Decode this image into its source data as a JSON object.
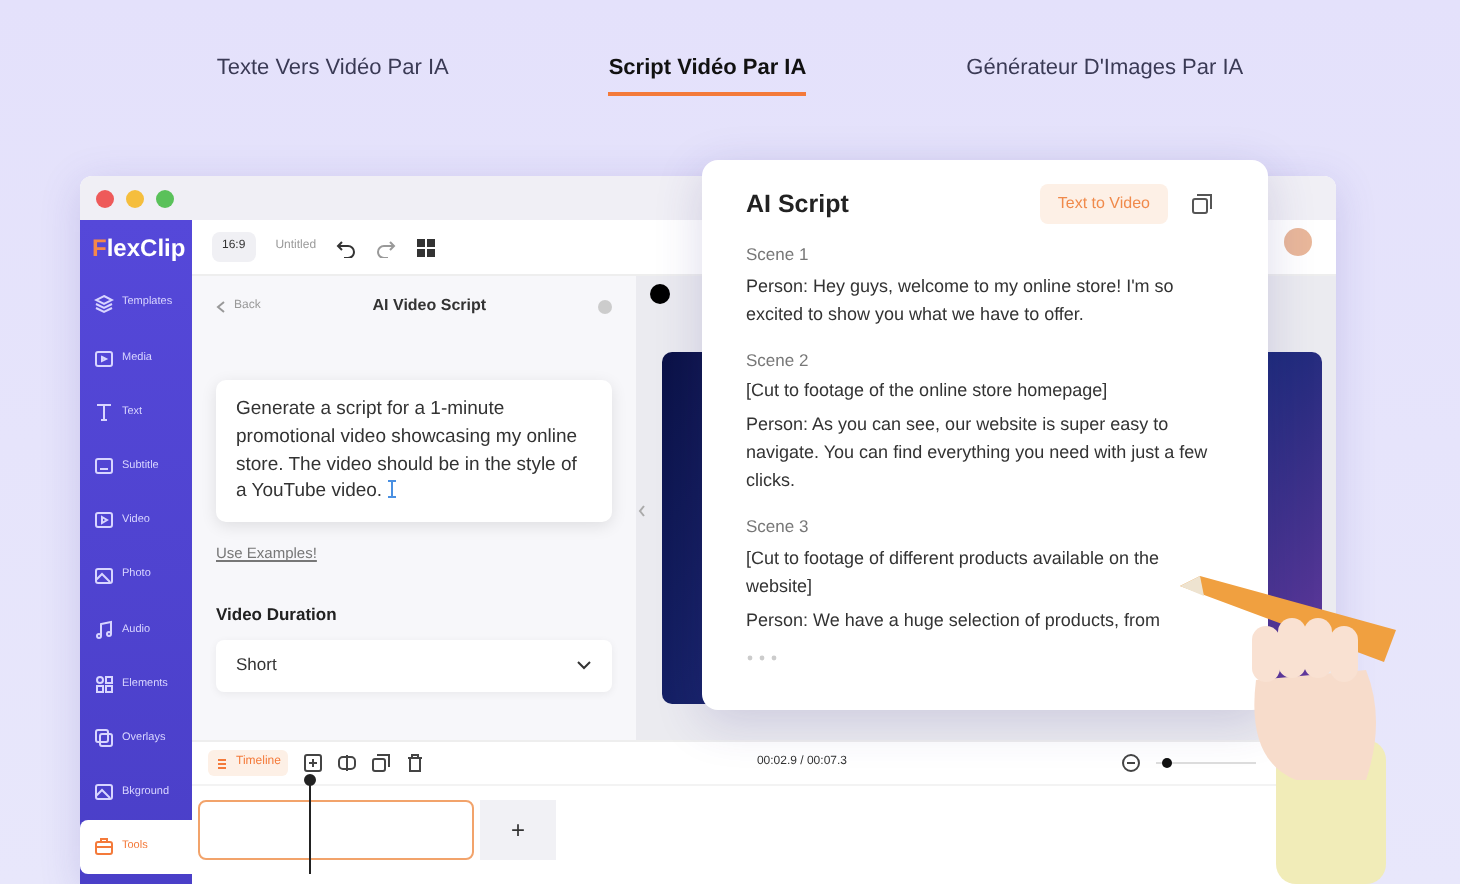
{
  "tabs": [
    {
      "label": "Texte Vers Vidéo Par IA",
      "selected": false
    },
    {
      "label": "Script Vidéo Par IA",
      "selected": true
    },
    {
      "label": "Générateur D'Images Par IA",
      "selected": false
    }
  ],
  "app": {
    "logo": "FlexClip",
    "aspect": "16:9",
    "project_name": "Untitled",
    "sidebar": [
      {
        "label": "Templates",
        "selected": false
      },
      {
        "label": "Media",
        "selected": false
      },
      {
        "label": "Text",
        "selected": false
      },
      {
        "label": "Subtitle",
        "selected": false
      },
      {
        "label": "Video",
        "selected": false
      },
      {
        "label": "Photo",
        "selected": false
      },
      {
        "label": "Audio",
        "selected": false
      },
      {
        "label": "Elements",
        "selected": false
      },
      {
        "label": "Overlays",
        "selected": false
      },
      {
        "label": "Bkground",
        "selected": false
      },
      {
        "label": "Tools",
        "selected": true
      }
    ],
    "panel": {
      "back": "Back",
      "title": "AI Video Script",
      "prompt": "Generate a script for a 1-minute promotional video showcasing my online store. The video should be in the style of a YouTube video.",
      "examples_link": "Use Examples!",
      "duration_label": "Video Duration",
      "duration_value": "Short"
    },
    "timeline": {
      "label": "Timeline",
      "time": "00:02.9 / 00:07.3",
      "zoom": {
        "level": 0.05
      },
      "add": "+"
    }
  },
  "script_card": {
    "title": "AI Script",
    "action": "Text to Video",
    "scenes": [
      {
        "heading": "Scene 1",
        "lines": [
          "Person: Hey guys, welcome to my online store! I'm so excited to show you what we have to offer."
        ]
      },
      {
        "heading": "Scene 2",
        "lines": [
          "[Cut to footage of the online store homepage]",
          "Person: As you can see, our website is super easy to navigate. You can find everything you need with just a few clicks."
        ]
      },
      {
        "heading": "Scene 3",
        "lines": [
          "[Cut to footage of different products available on the website]",
          "Person: We have a huge selection of products, from"
        ]
      }
    ]
  }
}
